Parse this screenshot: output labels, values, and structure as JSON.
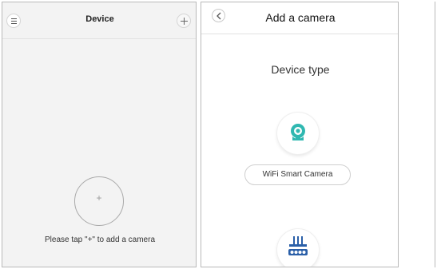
{
  "left_screen": {
    "title": "Device",
    "add_symbol": "+",
    "hint": "Please tap \"+\"  to add a camera",
    "icons": [
      "menu-icon",
      "plus-icon"
    ]
  },
  "right_screen": {
    "title": "Add a camera",
    "section_title": "Device type",
    "devices": [
      {
        "label": "WiFi Smart Camera",
        "icon": "camera-icon"
      },
      {
        "label": "",
        "icon": "router-icon"
      }
    ]
  },
  "colors": {
    "accent": "#2fb8b1",
    "left_background": "#f3f3f3",
    "border": "#b9b9b9"
  }
}
